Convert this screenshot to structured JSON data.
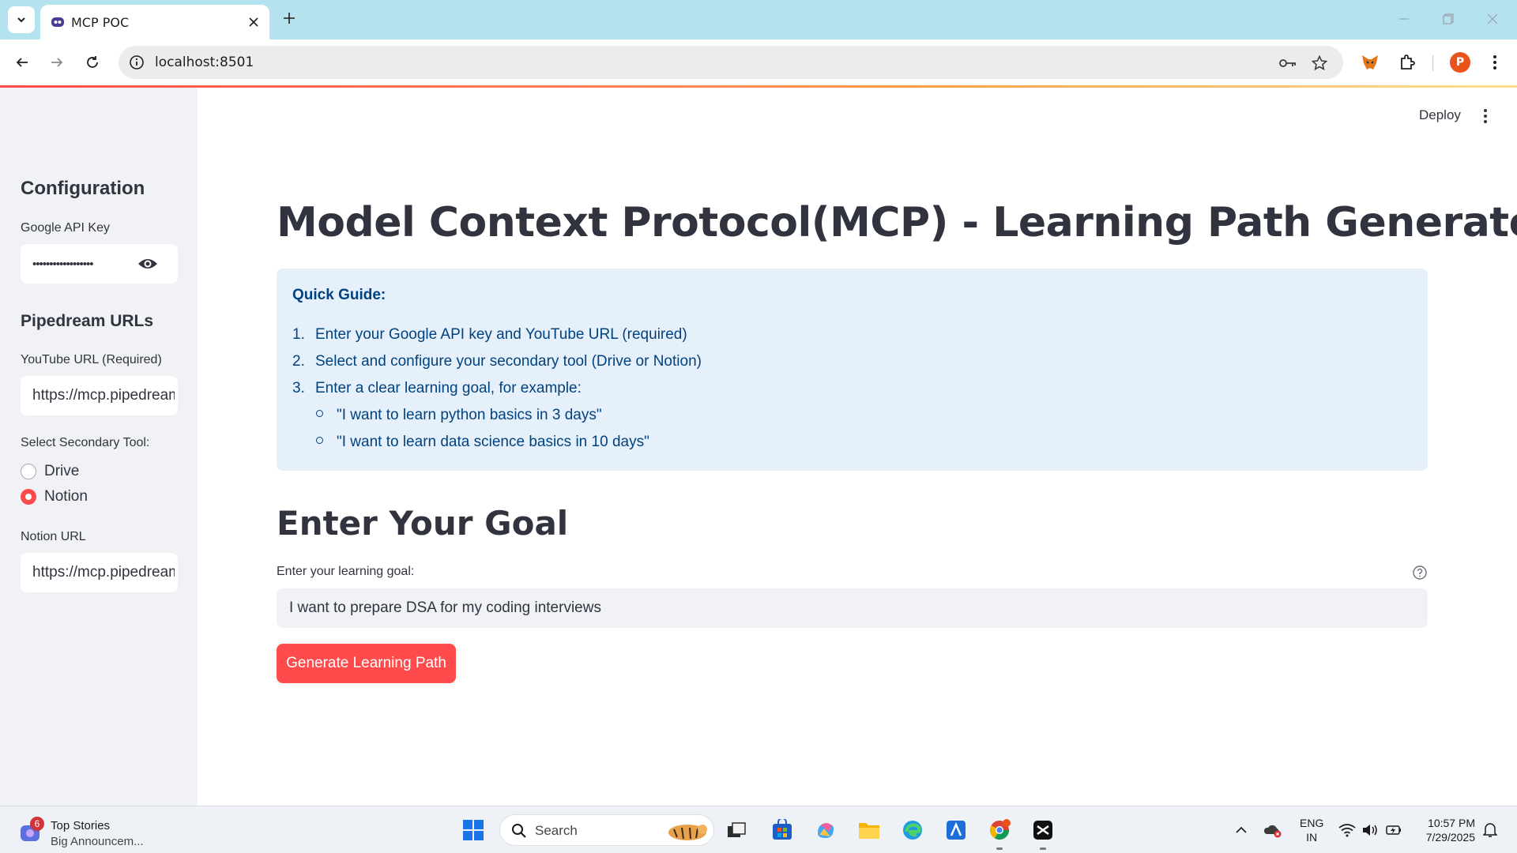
{
  "browser": {
    "tab_title": "MCP POC",
    "url": "localhost:8501",
    "profile_initial": "P"
  },
  "header": {
    "deploy_label": "Deploy"
  },
  "sidebar": {
    "config_heading": "Configuration",
    "api_key_label": "Google API Key",
    "api_key_value": "••••••••••••••••••",
    "pipedream_heading": "Pipedream URLs",
    "youtube_label": "YouTube URL (Required)",
    "youtube_value": "https://mcp.pipedream",
    "secondary_label": "Select Secondary Tool:",
    "options": [
      {
        "label": "Drive",
        "checked": false
      },
      {
        "label": "Notion",
        "checked": true
      }
    ],
    "notion_label": "Notion URL",
    "notion_value": "https://mcp.pipedream"
  },
  "main": {
    "title": "Model Context Protocol(MCP) - Learning Path Generator",
    "guide": {
      "heading": "Quick Guide:",
      "steps": [
        "Enter your Google API key and YouTube URL (required)",
        "Select and configure your secondary tool (Drive or Notion)",
        "Enter a clear learning goal, for example:"
      ],
      "step_numbers": [
        "1.",
        "2.",
        "3."
      ],
      "examples": [
        "\"I want to learn python basics in 3 days\"",
        "\"I want to learn data science basics in 10 days\""
      ]
    },
    "goal_heading": "Enter Your Goal",
    "goal_label": "Enter your learning goal:",
    "goal_value": "I want to prepare DSA for my coding interviews",
    "generate_label": "Generate Learning Path"
  },
  "taskbar": {
    "news_badge": "6",
    "news_title": "Top Stories",
    "news_subtitle": "Big Announcem...",
    "search_label": "Search",
    "lang_top": "ENG",
    "lang_bottom": "IN",
    "time": "10:57 PM",
    "date": "7/29/2025"
  },
  "colors": {
    "accent": "#ff4b4b",
    "sidebar_bg": "#f0f2f6",
    "info_bg": "#e5f0fb",
    "info_text": "#004280",
    "tabbar_bg": "#b4e2ef"
  }
}
